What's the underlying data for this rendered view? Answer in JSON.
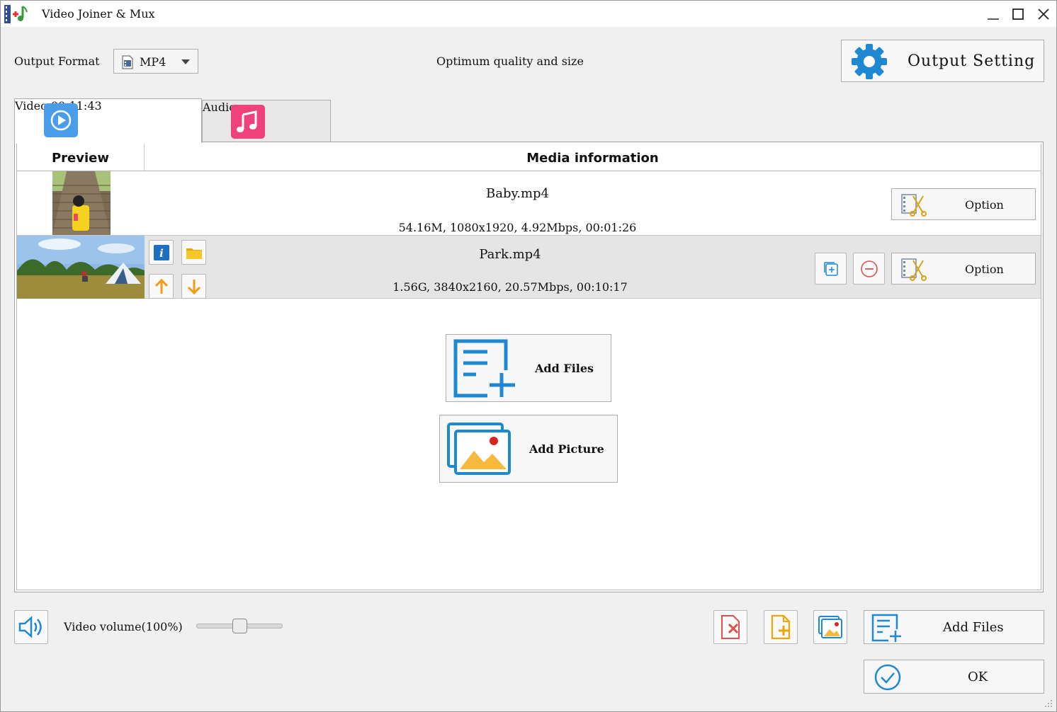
{
  "window": {
    "title": "Video Joiner & Mux",
    "minimize_icon": "minimize-icon",
    "maximize_icon": "maximize-icon",
    "close_icon": "close-icon"
  },
  "toolbar": {
    "output_format_label": "Output Format",
    "output_format_value": "MP4",
    "quality_text": "Optimum quality and size",
    "output_setting_label": "Output Setting"
  },
  "tabs": [
    {
      "label": "Video 00:11:43",
      "active": true,
      "icon": "play-icon"
    },
    {
      "label": "Audio",
      "active": false,
      "icon": "music-note-icon"
    }
  ],
  "table": {
    "columns": [
      "Preview",
      "Media information"
    ],
    "rows": [
      {
        "filename": "Baby.mp4",
        "details": "54.16M, 1080x1920, 4.92Mbps, 00:01:26",
        "option_label": "Option",
        "selected": false
      },
      {
        "filename": "Park.mp4",
        "details": "1.56G, 3840x2160, 20.57Mbps, 00:10:17",
        "option_label": "Option",
        "selected": true
      }
    ]
  },
  "center_actions": {
    "add_files_label": "Add Files",
    "add_picture_label": "Add Picture"
  },
  "bottom": {
    "volume_label": "Video volume(100%)",
    "volume_percent": 50,
    "add_files_label": "Add Files",
    "ok_label": "OK"
  },
  "colors": {
    "accent_blue": "#1e88d3",
    "audio_pink": "#f0427a",
    "arrow_orange": "#f39c12",
    "remove_red": "#e05050"
  }
}
